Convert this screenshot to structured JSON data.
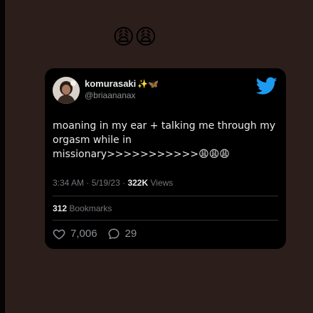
{
  "header": {
    "reaction_emoji": "😩😩"
  },
  "tweet": {
    "display_name": "komurasaki",
    "name_emoji": "✨🦋",
    "handle": "@briaananax",
    "text": "moaning in my ear + talking me through my orgasm while in missionary>>>>>>>>>>>😩😩😩",
    "time": "3:34 AM",
    "date": "5/19/23",
    "views_count": "322K",
    "views_label": "Views",
    "bookmarks_count": "312",
    "bookmarks_label": "Bookmarks",
    "likes": "7,006",
    "replies": "29"
  },
  "icons": {
    "bird": "twitter-bird-icon",
    "like": "heart-icon",
    "reply": "speech-bubble-icon",
    "brand_color": "#1d9bf0"
  }
}
